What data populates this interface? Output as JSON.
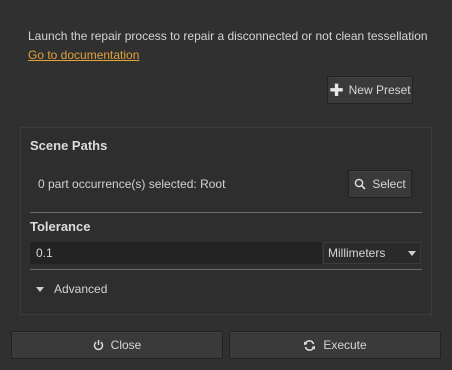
{
  "header": {
    "description": "Launch the repair process to repair a disconnected or not clean tessellation",
    "doc_link": "Go to documentation"
  },
  "preset": {
    "label": "New Preset",
    "icon": "plus-icon"
  },
  "scene_paths": {
    "title": "Scene Paths",
    "selection_text": "0 part occurrence(s) selected: Root",
    "select_label": "Select",
    "select_icon": "search-icon"
  },
  "tolerance": {
    "title": "Tolerance",
    "value": "0.1",
    "unit": "Millimeters"
  },
  "advanced": {
    "label": "Advanced"
  },
  "footer": {
    "close_label": "Close",
    "close_icon": "power-icon",
    "execute_label": "Execute",
    "execute_icon": "refresh-icon"
  },
  "colors": {
    "background": "#303030",
    "link": "#e0a23a",
    "input_bg": "#232323"
  }
}
